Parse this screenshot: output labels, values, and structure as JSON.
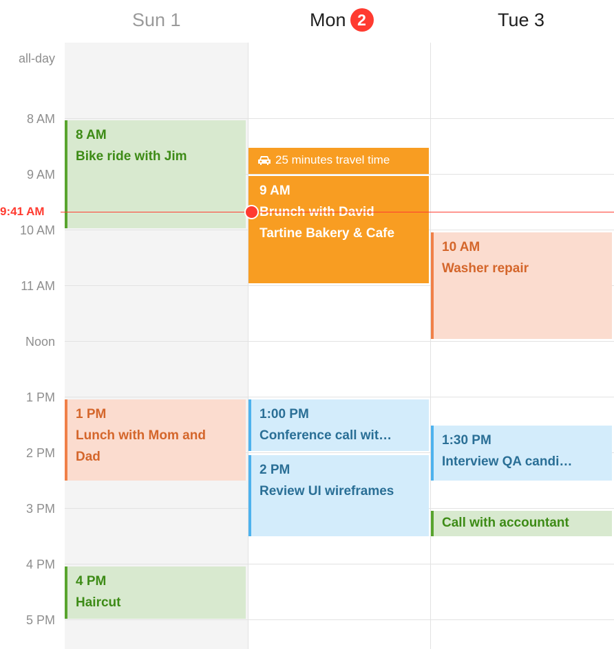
{
  "header": {
    "days": [
      {
        "label": "Sun 1"
      },
      {
        "label": "Mon",
        "badge": "2"
      },
      {
        "label": "Tue 3"
      }
    ]
  },
  "allday_label": "all-day",
  "time_labels": [
    "8 AM",
    "9 AM",
    "10 AM",
    "11 AM",
    "Noon",
    "1 PM",
    "2 PM",
    "3 PM",
    "4 PM",
    "5 PM"
  ],
  "current_time": "9:41 AM",
  "events": {
    "sun_bike": {
      "time": "8 AM",
      "title": "Bike ride with Jim",
      "color": "#58a42e"
    },
    "sun_lunch": {
      "time": "1 PM",
      "title1": "Lunch with Mom and",
      "title2": "Dad",
      "color": "#f08048"
    },
    "sun_haircut": {
      "time": "4 PM",
      "title": "Haircut",
      "color": "#58a42e"
    },
    "mon_travel": {
      "text": "25 minutes travel time",
      "icon": "car-icon"
    },
    "mon_brunch": {
      "time": "9 AM",
      "title": "Brunch with David",
      "location": "Tartine Bakery & Cafe",
      "color": "#f89d22"
    },
    "mon_conf": {
      "time": "1:00 PM",
      "title": "Conference call wit…",
      "color": "#4db2ee"
    },
    "mon_review": {
      "time": "2 PM",
      "title": "Review UI wireframes",
      "color": "#4db2ee"
    },
    "tue_washer": {
      "time": "10 AM",
      "title": "Washer repair",
      "color": "#f08048"
    },
    "tue_interview": {
      "time": "1:30 PM",
      "title": "Interview QA candi…",
      "color": "#4db2ee"
    },
    "tue_accountant": {
      "title": "Call with accountant",
      "color": "#58a42e"
    }
  }
}
